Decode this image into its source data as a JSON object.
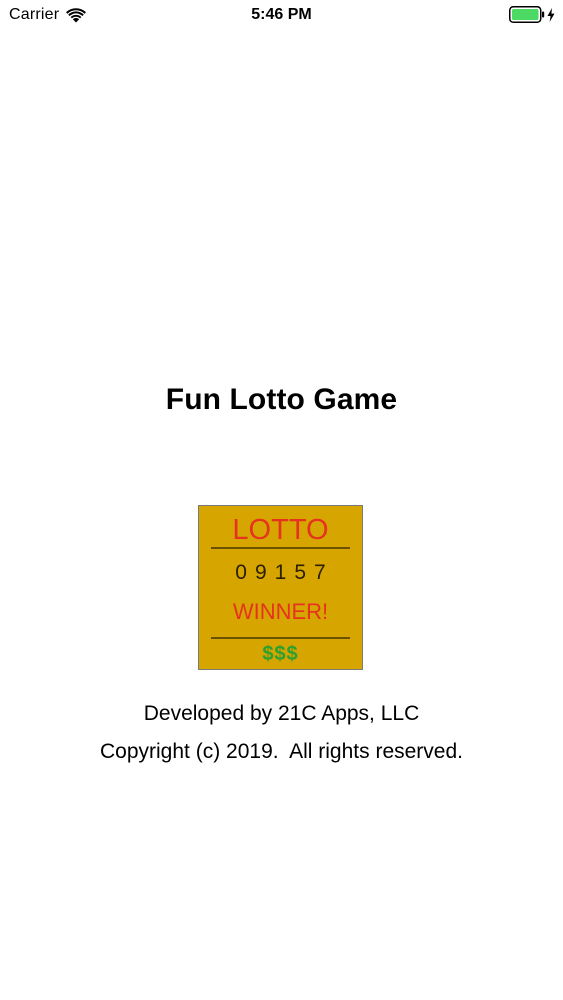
{
  "status_bar": {
    "carrier": "Carrier",
    "time": "5:46 PM",
    "icons": [
      "wifi-icon",
      "battery-icon",
      "charging-bolt-icon"
    ],
    "battery_color": "#4cd964"
  },
  "splash": {
    "title": "Fun Lotto Game",
    "logo": {
      "title": "LOTTO",
      "numbers": "09157",
      "winner": "WINNER!",
      "dollars": "$$$",
      "background_color": "#d6a500",
      "accent_color": "#e5331f",
      "money_color": "#2fa02f"
    },
    "developer": "Developed by 21C Apps, LLC",
    "copyright": "Copyright (c) 2019.  All rights reserved."
  }
}
